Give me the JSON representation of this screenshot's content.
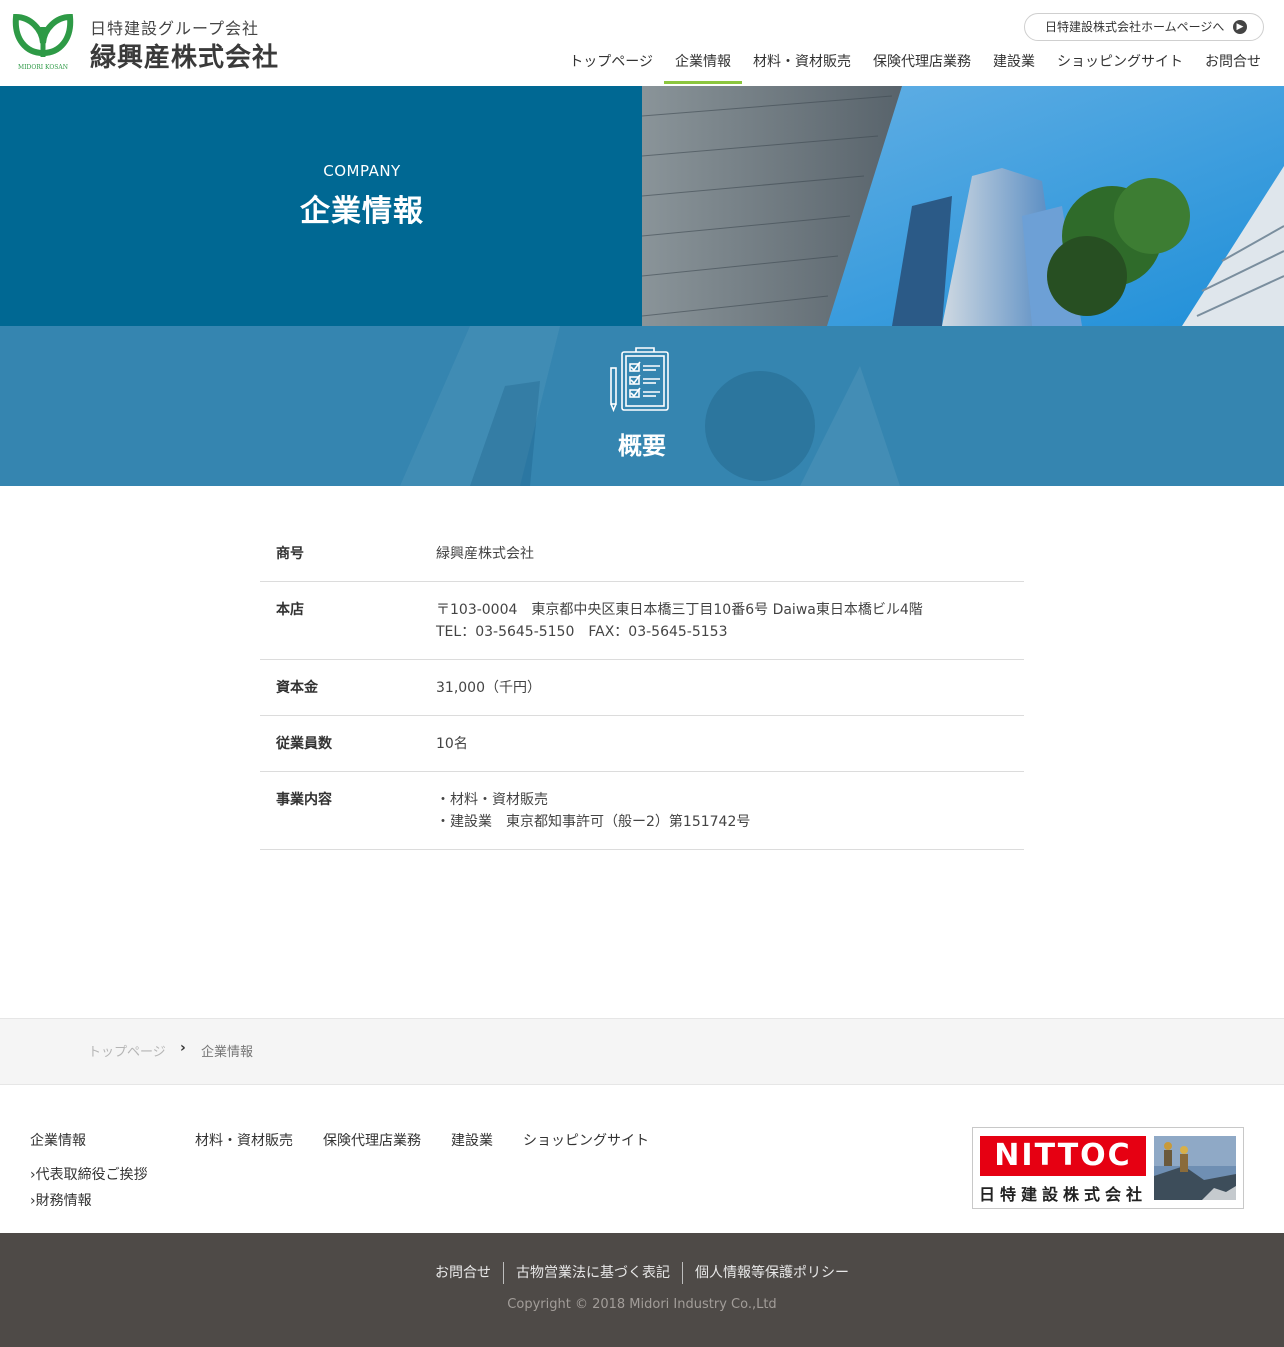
{
  "header": {
    "logo_sub": "日特建設グループ会社",
    "logo_main": "緑興産株式会社",
    "logo_mark_text": "MIDORI KOSAN",
    "homepage_link": "日特建設株式会社ホームページへ",
    "nav": [
      {
        "label": "トップページ",
        "active": false
      },
      {
        "label": "企業情報",
        "active": true
      },
      {
        "label": "材料・資材販売",
        "active": false
      },
      {
        "label": "保険代理店業務",
        "active": false
      },
      {
        "label": "建設業",
        "active": false
      },
      {
        "label": "ショッピングサイト",
        "active": false
      },
      {
        "label": "お問合せ",
        "active": false
      }
    ]
  },
  "hero": {
    "en": "COMPANY",
    "ja": "企業情報"
  },
  "section": {
    "title": "概要",
    "icon": "clipboard-checklist-icon"
  },
  "company_info": {
    "rows": [
      {
        "label": "商号",
        "lines": [
          "緑興産株式会社"
        ]
      },
      {
        "label": "本店",
        "lines": [
          "〒103-0004　東京都中央区東日本橋三丁目10番6号 Daiwa東日本橋ビル4階",
          "TEL：03-5645-5150　FAX：03-5645-5153"
        ]
      },
      {
        "label": "資本金",
        "lines": [
          "31,000（千円）"
        ]
      },
      {
        "label": "従業員数",
        "lines": [
          "10名"
        ]
      },
      {
        "label": "事業内容",
        "lines": [
          "・材料・資材販売",
          "・建設業　東京都知事許可（般ー2）第151742号"
        ]
      }
    ]
  },
  "breadcrumb": {
    "home": "トップページ",
    "current": "企業情報"
  },
  "footer_nav": {
    "company": "企業情報",
    "company_sub": [
      "代表取締役ご挨拶",
      "財務情報"
    ],
    "materials": "材料・資材販売",
    "insurance": "保険代理店業務",
    "construction": "建設業",
    "shopping": "ショッピングサイト"
  },
  "banner": {
    "brand": "NITTOC",
    "company": "日特建設株式会社"
  },
  "bottom": {
    "links": [
      "お問合せ",
      "古物営業法に基づく表記",
      "個人情報等保護ポリシー"
    ],
    "copyright": "Copyright © 2018 Midori Industry Co.,Ltd"
  },
  "colors": {
    "hero_blue": "#006893",
    "section_blue": "#3585b0",
    "nav_active": "#8cc63f",
    "logo_green": "#2e9a46",
    "footer_dark": "#4e4a47",
    "nittoc_red": "#e60012"
  }
}
